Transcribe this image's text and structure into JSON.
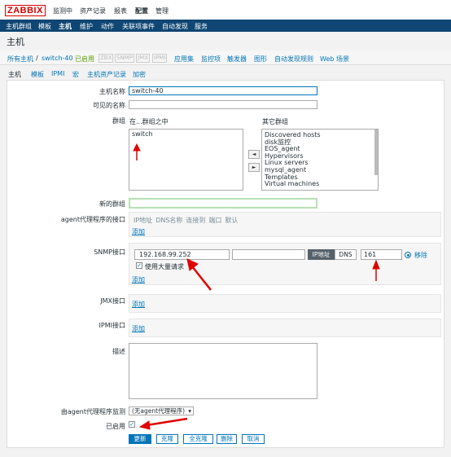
{
  "logo": "ZABBIX",
  "top_menu": [
    {
      "label": "监测中",
      "active": false
    },
    {
      "label": "资产记录",
      "active": false
    },
    {
      "label": "报表",
      "active": false
    },
    {
      "label": "配置",
      "active": true
    },
    {
      "label": "管理",
      "active": false
    }
  ],
  "sub_menu": [
    {
      "label": "主机群组",
      "active": false
    },
    {
      "label": "模板",
      "active": false
    },
    {
      "label": "主机",
      "active": true
    },
    {
      "label": "维护",
      "active": false
    },
    {
      "label": "动作",
      "active": false
    },
    {
      "label": "关联项事件",
      "active": false
    },
    {
      "label": "自动发现",
      "active": false
    },
    {
      "label": "服务",
      "active": false
    }
  ],
  "page_title": "主机",
  "host_nav": {
    "all_hosts": "所有主机",
    "separator": "/",
    "current_host": "switch-40",
    "status": "已启用",
    "tags": [
      "ZBX",
      "SNMP",
      "JMX",
      "IPMI"
    ],
    "links": [
      "应用集",
      "监控项",
      "触发器",
      "图形",
      "自动发现规则",
      "Web 场景"
    ]
  },
  "tabs": [
    {
      "label": "主机",
      "active": true
    },
    {
      "label": "模板",
      "active": false
    },
    {
      "label": "IPMI",
      "active": false
    },
    {
      "label": "宏",
      "active": false
    },
    {
      "label": "主机资产记录",
      "active": false
    },
    {
      "label": "加密",
      "active": false
    }
  ],
  "form": {
    "host_name_label": "主机名称",
    "host_name_value": "switch-40",
    "visible_name_label": "可见的名称",
    "visible_name_value": "",
    "groups_label": "群组",
    "in_groups_label": "在...群组之中",
    "in_groups": [
      "switch"
    ],
    "other_groups_label": "其它群组",
    "other_groups": [
      "Discovered hosts",
      "disk监控",
      "EOS_agent",
      "Hypervisors",
      "Linux servers",
      "mysql_agent",
      "Templates",
      "Virtual machines"
    ],
    "move_left": "◄",
    "move_right": "►",
    "new_group_label": "新的群组",
    "new_group_value": "",
    "agent_iface_label": "agent代理程序的接口",
    "iface_headers": [
      "IP地址",
      "DNS名称",
      "连接到",
      "端口",
      "默认"
    ],
    "add_label": "添加",
    "snmp_label": "SNMP接口",
    "snmp_ip": "192.168.99.252",
    "snmp_dns": "",
    "ip_button": "IP地址",
    "dns_button": "DNS",
    "snmp_port": "161",
    "remove_label": "移除",
    "bulk_label": "使用大量请求",
    "jmx_label": "JMX接口",
    "ipmi_label": "IPMI接口",
    "desc_label": "描述",
    "desc_value": "",
    "proxy_label": "由agent代理程序监测",
    "proxy_value": "(无agent代理程序)",
    "enabled_label": "已启用",
    "check_mark": "✓",
    "buttons": [
      "更新",
      "克隆",
      "全克隆",
      "删除",
      "取消"
    ]
  },
  "colors": {
    "accent": "#0275b8",
    "navbar": "#0f4673",
    "annotation": "#e00000",
    "enabled": "#59a100"
  }
}
